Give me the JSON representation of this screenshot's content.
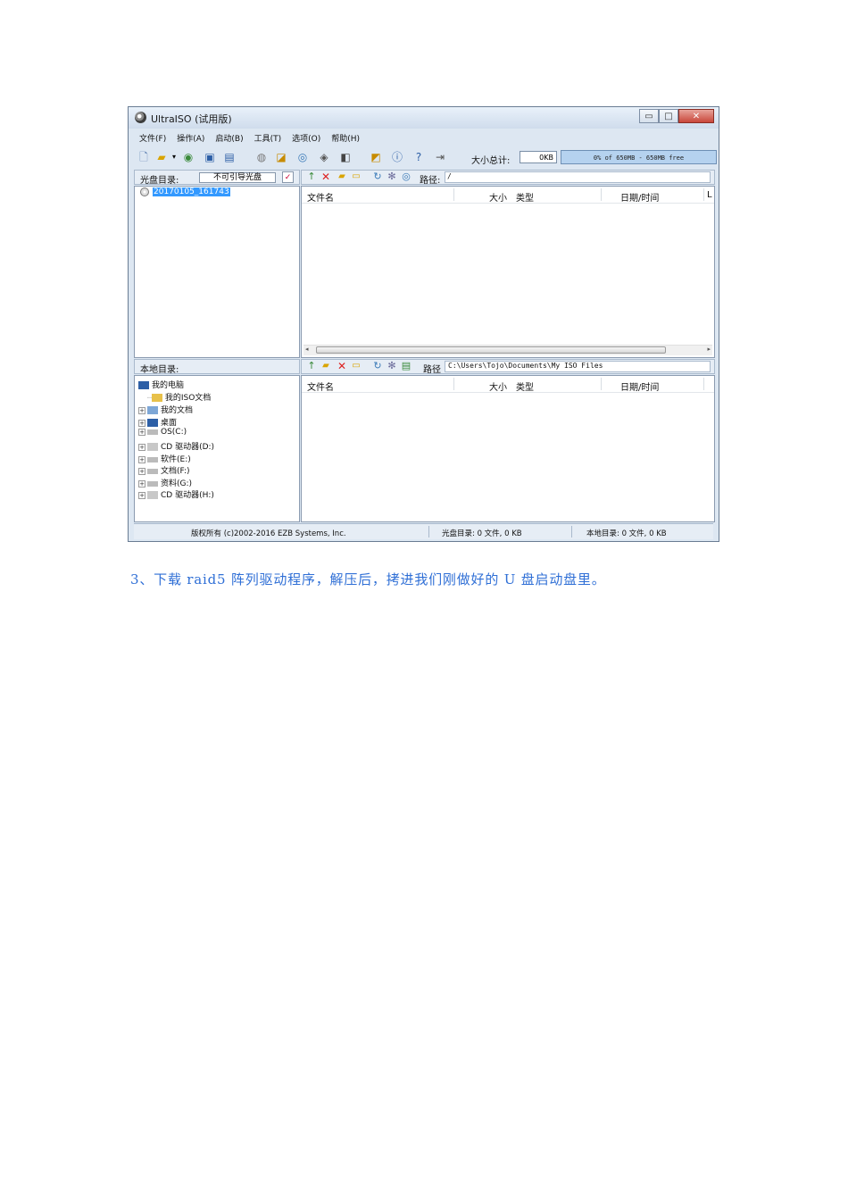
{
  "window": {
    "title": "UltraISO (试用版)",
    "caption_buttons": {
      "minimize": "▭",
      "maximize": "□",
      "close": "✕"
    }
  },
  "menu": [
    "文件(F)",
    "操作(A)",
    "启动(B)",
    "工具(T)",
    "选项(O)",
    "帮助(H)"
  ],
  "toolbar": {
    "size_total_label": "大小总计:",
    "size_total_value": "0KB",
    "capacity_text": "0% of 650MB - 650MB free",
    "capacity_fraction": 0
  },
  "cd_bar": {
    "label": "光盘目录:",
    "volume_label": "不可引导光盘",
    "path_label": "路径:",
    "path_value": "/"
  },
  "cd_tree": {
    "root": "20170105_161743"
  },
  "columns": {
    "filename": "文件名",
    "size": "大小",
    "type": "类型",
    "date": "日期/时间",
    "extra": "L"
  },
  "local_bar": {
    "label": "本地目录:",
    "path_label": "路径",
    "path_value": "C:\\Users\\Tojo\\Documents\\My ISO Files"
  },
  "local_tree": [
    {
      "label": "我的电脑",
      "icon": "computer-icon",
      "expander": ""
    },
    {
      "label": "我的ISO文档",
      "icon": "folder-icon",
      "expander": ""
    },
    {
      "label": "我的文档",
      "icon": "documents-icon",
      "expander": "+"
    },
    {
      "label": "桌面",
      "icon": "desktop-icon",
      "expander": "+"
    },
    {
      "label": "OS(C:)",
      "icon": "drive-icon",
      "expander": "+"
    },
    {
      "label": "CD 驱动器(D:)",
      "icon": "cd-drive-icon",
      "expander": "+"
    },
    {
      "label": "软件(E:)",
      "icon": "drive-icon",
      "expander": "+"
    },
    {
      "label": "文档(F:)",
      "icon": "drive-icon",
      "expander": "+"
    },
    {
      "label": "资料(G:)",
      "icon": "drive-icon",
      "expander": "+"
    },
    {
      "label": "CD 驱动器(H:)",
      "icon": "cd-drive-icon",
      "expander": "+"
    }
  ],
  "status": {
    "copyright": "版权所有 (c)2002-2016 EZB Systems, Inc.",
    "cd_dir": "光盘目录: 0 文件, 0 KB",
    "local_dir": "本地目录: 0 文件, 0 KB"
  },
  "caption": "3、下载 raid5 阵列驱动程序，解压后，拷进我们刚做好的 U 盘启动盘里。",
  "colors": {
    "caption": "#2f6fd6",
    "selection": "#3399ff",
    "capacity_bar": "#b5d2ef"
  }
}
